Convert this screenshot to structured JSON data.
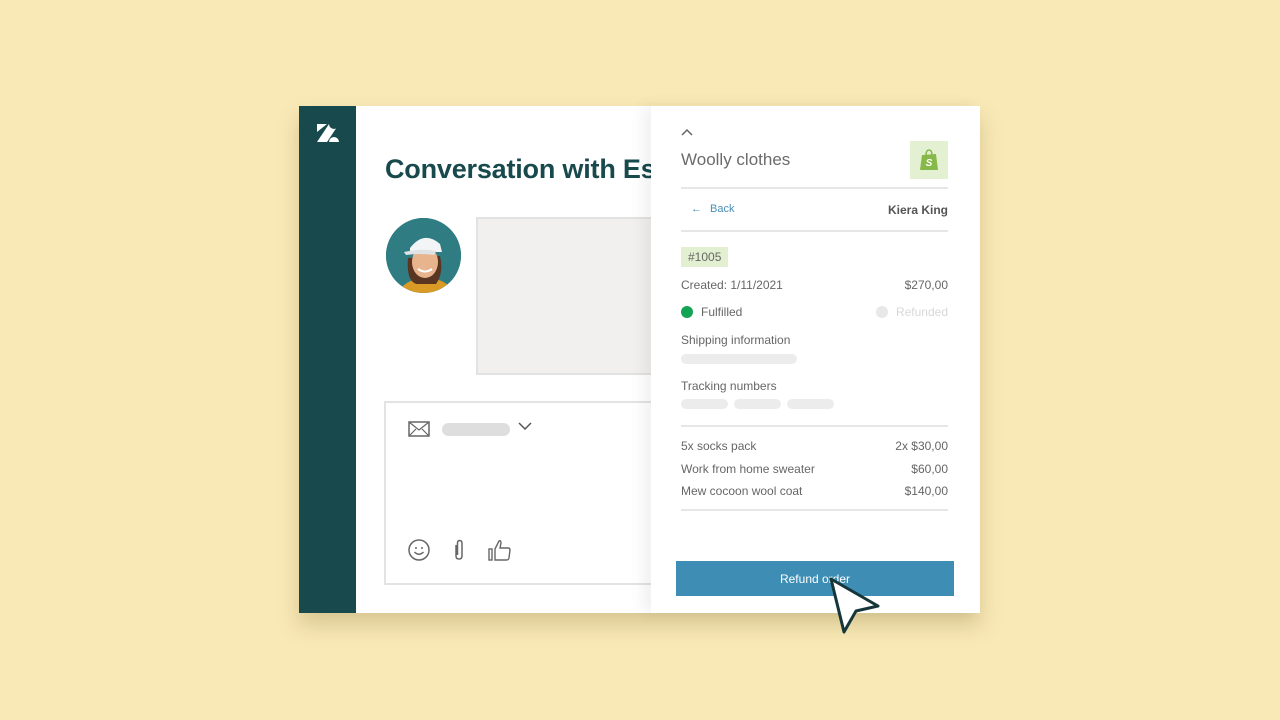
{
  "brand": {
    "logo_icon": "zendesk-logo-icon",
    "sidebar_color": "#17494d"
  },
  "conversation": {
    "title": "Conversation with Esther",
    "composer": {
      "channel_icon": "envelope-icon",
      "dropdown_icon": "chevron-down-icon",
      "tools": [
        "emoji-icon",
        "paperclip-icon",
        "thumbs-up-icon"
      ]
    }
  },
  "order_panel": {
    "collapse_icon": "chevron-up-icon",
    "store_name": "Woolly clothes",
    "store_icon": "shopify-bag-icon",
    "back_label": "Back",
    "customer_name": "Kiera King",
    "order_number": "#1005",
    "created": "Created: 1/11/2021",
    "total": "$270,00",
    "statuses": [
      {
        "label": "Fulfilled",
        "color": "#12a454",
        "active": true
      },
      {
        "label": "Refunded",
        "color": "#e4e4e4",
        "active": false
      }
    ],
    "shipping_label": "Shipping information",
    "tracking_label": "Tracking numbers",
    "line_items": [
      {
        "name": "5x socks pack",
        "price": "2x $30,00"
      },
      {
        "name": "Work from home sweater",
        "price": "$60,00"
      },
      {
        "name": "Mew cocoon wool coat",
        "price": "$140,00"
      }
    ],
    "refund_button": "Refund order",
    "accent": "#3d8db5"
  }
}
